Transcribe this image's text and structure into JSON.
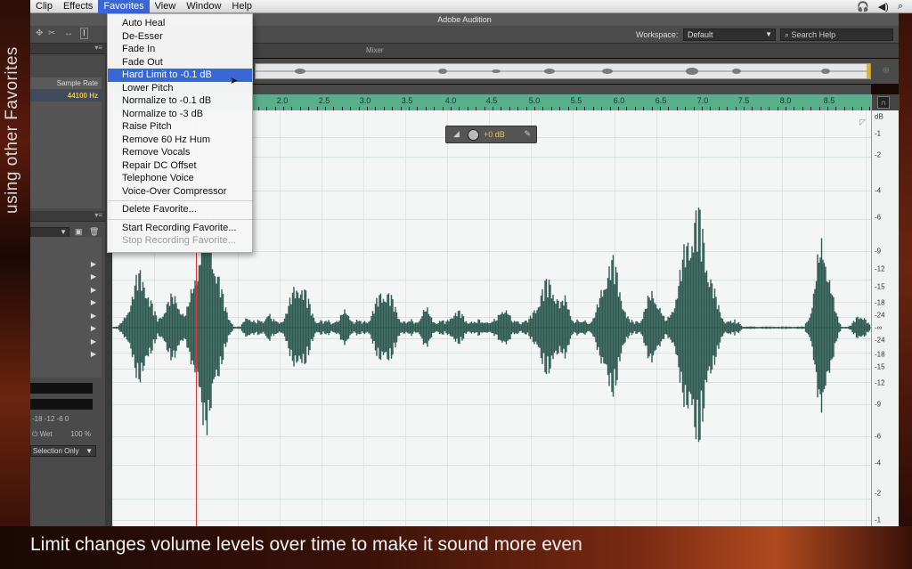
{
  "menubar": {
    "items": [
      {
        "label": "Clip"
      },
      {
        "label": "Effects"
      },
      {
        "label": "Favorites",
        "active": true
      },
      {
        "label": "View"
      },
      {
        "label": "Window"
      },
      {
        "label": "Help"
      }
    ]
  },
  "app": {
    "title": "Adobe Audition"
  },
  "toolbar": {
    "workspace_label": "Workspace:",
    "workspace_value": "Default",
    "search_placeholder": "Search Help"
  },
  "files_panel": {
    "column_header": "Sample Rate",
    "sample_rate": "44100 Hz"
  },
  "editor": {
    "mixer_tab": "Mixer",
    "amplitude_readout": "+0 dB"
  },
  "effects_panel": {
    "meter_scale": "-18  -12  -6   0",
    "wet_label": "Wet",
    "wet_value": "100 %",
    "selection_option": "Selection Only"
  },
  "ruler": {
    "labels": [
      "2.0",
      "2.5",
      "3.0",
      "3.5",
      "4.0",
      "4.5",
      "5.0",
      "5.5",
      "6.0",
      "6.5",
      "7.0",
      "7.5",
      "8.0",
      "8.5"
    ]
  },
  "db_scale": {
    "unit": "dB",
    "labels": [
      "-1",
      "-2",
      "-4",
      "-6",
      "-9",
      "-12",
      "-15",
      "-18",
      "-24",
      "-∞",
      "-24",
      "-18",
      "-15",
      "-12",
      "-9",
      "-6",
      "-4",
      "-2",
      "-1"
    ]
  },
  "favorites_menu": {
    "items": [
      {
        "label": "Auto Heal"
      },
      {
        "label": "De-Esser"
      },
      {
        "label": "Fade In"
      },
      {
        "label": "Fade Out"
      },
      {
        "label": "Hard Limit to -0.1 dB",
        "highlighted": true
      },
      {
        "label": "Lower Pitch"
      },
      {
        "label": "Normalize to -0.1 dB"
      },
      {
        "label": "Normalize to -3 dB"
      },
      {
        "label": "Raise Pitch"
      },
      {
        "label": "Remove 60 Hz Hum"
      },
      {
        "label": "Remove Vocals"
      },
      {
        "label": "Repair DC Offset"
      },
      {
        "label": "Telephone Voice"
      },
      {
        "label": "Voice-Over Compressor"
      }
    ],
    "delete_label": "Delete Favorite...",
    "start_recording_label": "Start Recording Favorite...",
    "stop_recording_label": "Stop Recording Favorite..."
  },
  "captions": {
    "side": "using other Favorites",
    "bottom": "Limit changes volume levels over time to make it sound more even"
  },
  "colors": {
    "accent": "#3a66d6",
    "ruler": "#58b08a",
    "waveform": "#2e5a50",
    "playhead": "#dd3333"
  },
  "icons": [
    "apple-headphones-icon",
    "volume-icon",
    "spotlight-search-icon",
    "search-icon",
    "knob-icon",
    "headphones-icon"
  ]
}
